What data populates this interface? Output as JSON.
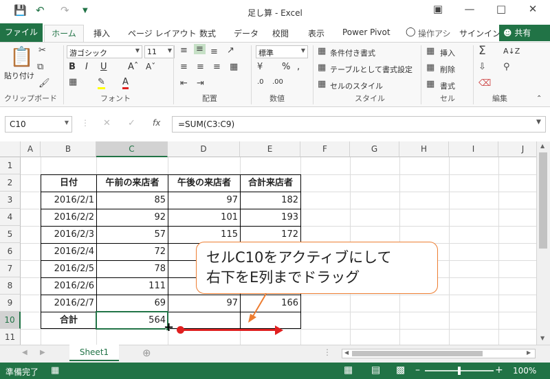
{
  "title": "足し算 - Excel",
  "tabs": [
    "ファイル",
    "ホーム",
    "挿入",
    "ページ レイアウト",
    "数式",
    "データ",
    "校閲",
    "表示",
    "Power Pivot",
    "操作アシ",
    "サインイン",
    "共有"
  ],
  "ribbon": {
    "paste": "貼り付け",
    "clipboard": "クリップボード",
    "font_name": "游ゴシック",
    "font_size": "11",
    "font": "フォント",
    "align": "配置",
    "number_format": "標準",
    "number": "数値",
    "cond_format": "条件付き書式",
    "table_format": "テーブルとして書式設定",
    "cell_style": "セルのスタイル",
    "style": "スタイル",
    "insert": "挿入",
    "delete": "削除",
    "format": "書式",
    "cells": "セル",
    "edit": "編集"
  },
  "formula_bar": {
    "name_box": "C10",
    "fx": "fx",
    "formula": "=SUM(C3:C9)"
  },
  "columns": [
    "A",
    "B",
    "C",
    "D",
    "E",
    "F",
    "G",
    "H",
    "I",
    "J"
  ],
  "rows": [
    "1",
    "2",
    "3",
    "4",
    "5",
    "6",
    "7",
    "8",
    "9",
    "10",
    "11"
  ],
  "table": {
    "headers": [
      "日付",
      "午前の来店者",
      "午後の来店者",
      "合計来店者"
    ],
    "data": [
      [
        "2016/2/1",
        "85",
        "97",
        "182"
      ],
      [
        "2016/2/2",
        "92",
        "101",
        "193"
      ],
      [
        "2016/2/3",
        "57",
        "115",
        "172"
      ],
      [
        "2016/2/4",
        "72",
        "",
        ""
      ],
      [
        "2016/2/5",
        "78",
        "",
        ""
      ],
      [
        "2016/2/6",
        "111",
        "",
        ""
      ],
      [
        "2016/2/7",
        "69",
        "97",
        "166"
      ]
    ],
    "total_label": "合計",
    "total_value": "564"
  },
  "callout": {
    "line1": "セルC10をアクティブにして",
    "line2": "右下をE列までドラッグ"
  },
  "sheet_tab": "Sheet1",
  "status": {
    "ready": "準備完了",
    "zoom": "100%"
  },
  "colors": {
    "excel_green": "#217346",
    "callout_border": "#ed7d31",
    "arrow_red": "#e02020"
  }
}
